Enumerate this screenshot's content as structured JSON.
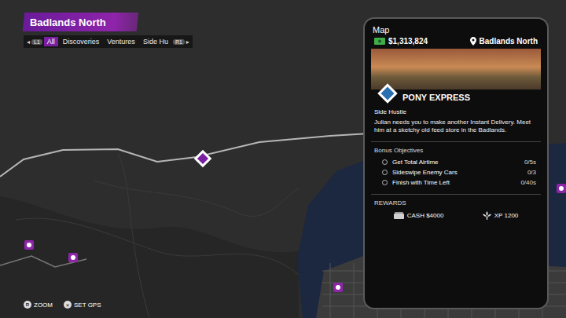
{
  "header": {
    "title": "Badlands North"
  },
  "filter_bar": {
    "prev_arrow": "◂",
    "prev_button": "L1",
    "next_button": "R1",
    "next_arrow": "▸",
    "tabs": [
      {
        "label": "All",
        "selected": true
      },
      {
        "label": "Discoveries",
        "selected": false
      },
      {
        "label": "Ventures",
        "selected": false
      },
      {
        "label": "Side Hu",
        "selected": false
      }
    ]
  },
  "controls": [
    {
      "button": "R",
      "label": "ZOOM"
    },
    {
      "button": "✕",
      "label": "SET GPS"
    }
  ],
  "phone": {
    "app": "Map",
    "cash": "$1,313,824",
    "location": "Badlands North",
    "mission": {
      "title": "PONY EXPRESS",
      "type": "Side Hustle",
      "description": "Julian needs you to make another Instant Delivery. Meet him at a sketchy old feed store in the Badlands."
    },
    "bonus": {
      "title": "Bonus Objectives",
      "objectives": [
        {
          "label": "Get Total Airtime",
          "progress": "0/5s",
          "done": false
        },
        {
          "label": "Sideswipe Enemy Cars",
          "progress": "0/3",
          "done": false
        },
        {
          "label": "Finish with Time Left",
          "progress": "0/40s",
          "done": false
        }
      ]
    },
    "rewards": {
      "title": "REWARDS",
      "items": [
        {
          "label": "CASH $4000",
          "kind": "cash"
        },
        {
          "label": "XP 1200",
          "kind": "xp"
        }
      ]
    }
  }
}
